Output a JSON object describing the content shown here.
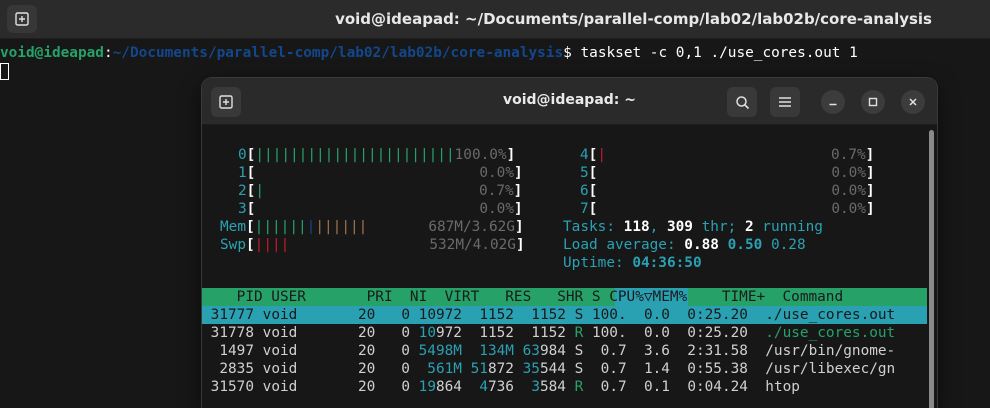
{
  "back": {
    "title": "void@ideapad: ~/Documents/parallel-comp/lab02/lab02b/core-analysis",
    "prompt_user": "void@ideapad",
    "prompt_colon": ":",
    "prompt_path": "~/Documents/parallel-comp/lab02/lab02b/core-analysis",
    "prompt_cmd": "$ taskset -c 0,1 ./use_cores.out 1"
  },
  "front": {
    "title": "void@ideapad: ~"
  },
  "htop": {
    "cpus_left": [
      {
        "id": "0",
        "bar": "|||||||||||||||||||||||",
        "val": "100.0%"
      },
      {
        "id": "1",
        "bar": "",
        "val": "0.0%"
      },
      {
        "id": "2",
        "bar": "|",
        "val": "0.7%"
      },
      {
        "id": "3",
        "bar": "",
        "val": "0.0%"
      }
    ],
    "cpus_right": [
      {
        "id": "4",
        "bar": "|",
        "val": "0.7%"
      },
      {
        "id": "5",
        "bar": "",
        "val": "0.0%"
      },
      {
        "id": "6",
        "bar": "",
        "val": "0.0%"
      },
      {
        "id": "7",
        "bar": "",
        "val": "0.0%"
      }
    ],
    "mem_label": "Mem",
    "mem_val": "687M/3.62G",
    "swp_label": "Swp",
    "swp_val": "532M/4.02G",
    "tasks_label": "Tasks: ",
    "tasks_n": "118",
    "thr_n": "309",
    "thr_label": " thr; ",
    "running_n": "2",
    "running_label": " running",
    "load_label": "Load average: ",
    "load1": "0.88",
    "load5": "0.50",
    "load15": "0.28",
    "uptime_label": "Uptime: ",
    "uptime": "04:36:50",
    "header": "    PID USER       PRI  NI  VIRT   RES   SHR S ",
    "header_sel": "CPU%▽",
    "header_rest": "MEM%    TIME+  Command",
    "rows": [
      {
        "pid": "31777",
        "user": "void",
        "pri": "20",
        "ni": "0",
        "virt": "10972",
        "res": "1152",
        "shr": "1152",
        "s": "S",
        "cpu": "100.",
        "mem": "0.0",
        "time": "0:25.20",
        "cmd": "./use_cores.out"
      },
      {
        "pid": "31778",
        "user": "void",
        "pri": "20",
        "ni": "0",
        "virt": "10972",
        "res": "1152",
        "shr": "1152",
        "s": "R",
        "cpu": "100.",
        "mem": "0.0",
        "time": "0:25.20",
        "cmd": "./use_cores.out"
      },
      {
        "pid": "1497",
        "user": "void",
        "pri": "20",
        "ni": "0",
        "virt": "5498M",
        "res": "134M",
        "shr": "63984",
        "s": "S",
        "cpu": "0.7",
        "mem": "3.6",
        "time": "2:31.58",
        "cmd": "/usr/bin/gnome-"
      },
      {
        "pid": "2835",
        "user": "void",
        "pri": "20",
        "ni": "0",
        "virt": "561M",
        "res": "51872",
        "shr": "35544",
        "s": "S",
        "cpu": "0.7",
        "mem": "1.4",
        "time": "0:55.38",
        "cmd": "/usr/libexec/gn"
      },
      {
        "pid": "31570",
        "user": "void",
        "pri": "20",
        "ni": "0",
        "virt": "19864",
        "res": "4736",
        "shr": "3584",
        "s": "R",
        "cpu": "0.7",
        "mem": "0.1",
        "time": "0:04.24",
        "cmd": "htop"
      }
    ]
  }
}
